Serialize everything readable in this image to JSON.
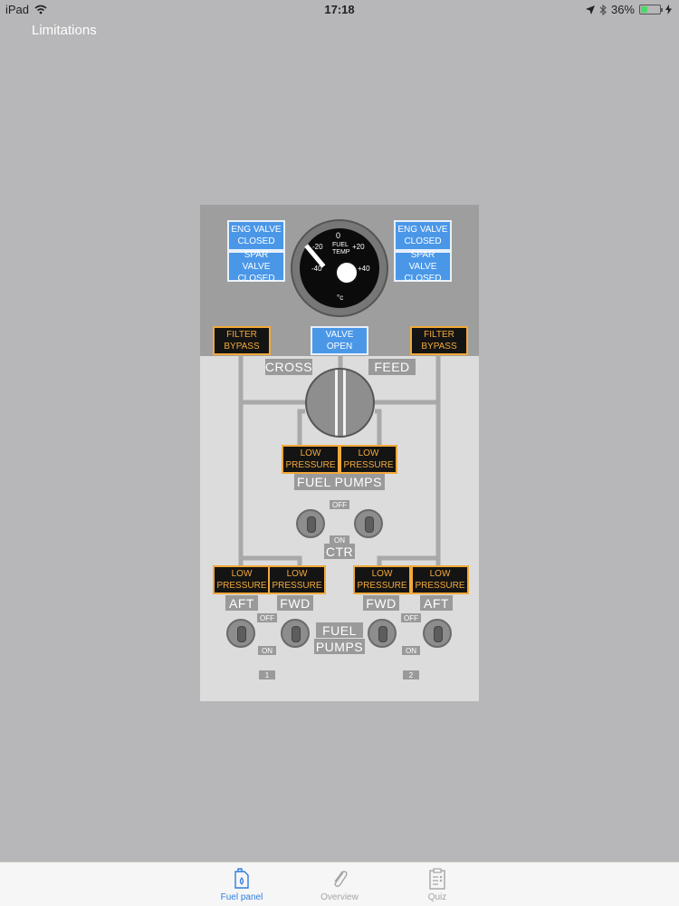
{
  "status_bar": {
    "device": "iPad",
    "time": "17:18",
    "battery": "36%",
    "battery_level": 0.36,
    "icons": [
      "wifi-icon",
      "location-arrow-icon",
      "bluetooth-icon",
      "battery-icon",
      "charging-bolt-icon"
    ]
  },
  "nav": {
    "back_label": "Limitations"
  },
  "panel": {
    "eng_valve_left": [
      "ENG VALVE",
      "CLOSED"
    ],
    "spar_valve_left": [
      "SPAR VALVE",
      "CLOSED"
    ],
    "eng_valve_right": [
      "ENG VALVE",
      "CLOSED"
    ],
    "spar_valve_right": [
      "SPAR VALVE",
      "CLOSED"
    ],
    "gauge": {
      "title_1": "FUEL",
      "title_2": "TEMP",
      "mark_0": "0",
      "mark_plus20": "+20",
      "mark_minus20": "-20",
      "mark_minus40": "-40",
      "mark_plus40": "+40",
      "unit": "°c"
    },
    "filter_bypass_left": [
      "FILTER",
      "BYPASS"
    ],
    "filter_bypass_right": [
      "FILTER",
      "BYPASS"
    ],
    "valve_open": [
      "VALVE",
      "OPEN"
    ],
    "cross_label": "CROSS",
    "feed_label": "FEED",
    "ctr_low_pressure_left": [
      "LOW",
      "PRESSURE"
    ],
    "ctr_low_pressure_right": [
      "LOW",
      "PRESSURE"
    ],
    "fuel_pumps_label": "FUEL PUMPS",
    "off_label": "OFF",
    "on_label": "ON",
    "ctr_label": "CTR",
    "aft_lp_1": [
      "LOW",
      "PRESSURE"
    ],
    "fwd_lp_1": [
      "LOW",
      "PRESSURE"
    ],
    "fwd_lp_2": [
      "LOW",
      "PRESSURE"
    ],
    "aft_lp_2": [
      "LOW",
      "PRESSURE"
    ],
    "aft_label": "AFT",
    "fwd_label": "FWD",
    "fuel_label": "FUEL",
    "pumps_label": "PUMPS",
    "engine_1": "1",
    "engine_2": "2"
  },
  "tabs": [
    {
      "label": "Fuel panel",
      "icon": "fuel-can-icon",
      "active": true
    },
    {
      "label": "Overview",
      "icon": "paperclip-icon",
      "active": false
    },
    {
      "label": "Quiz",
      "icon": "clipboard-checklist-icon",
      "active": false
    }
  ],
  "colors": {
    "background": "#b7b6b8",
    "lamp_blue": "#4a97e8",
    "lamp_amber": "#f2a93b",
    "tab_active": "#2f7de1"
  }
}
